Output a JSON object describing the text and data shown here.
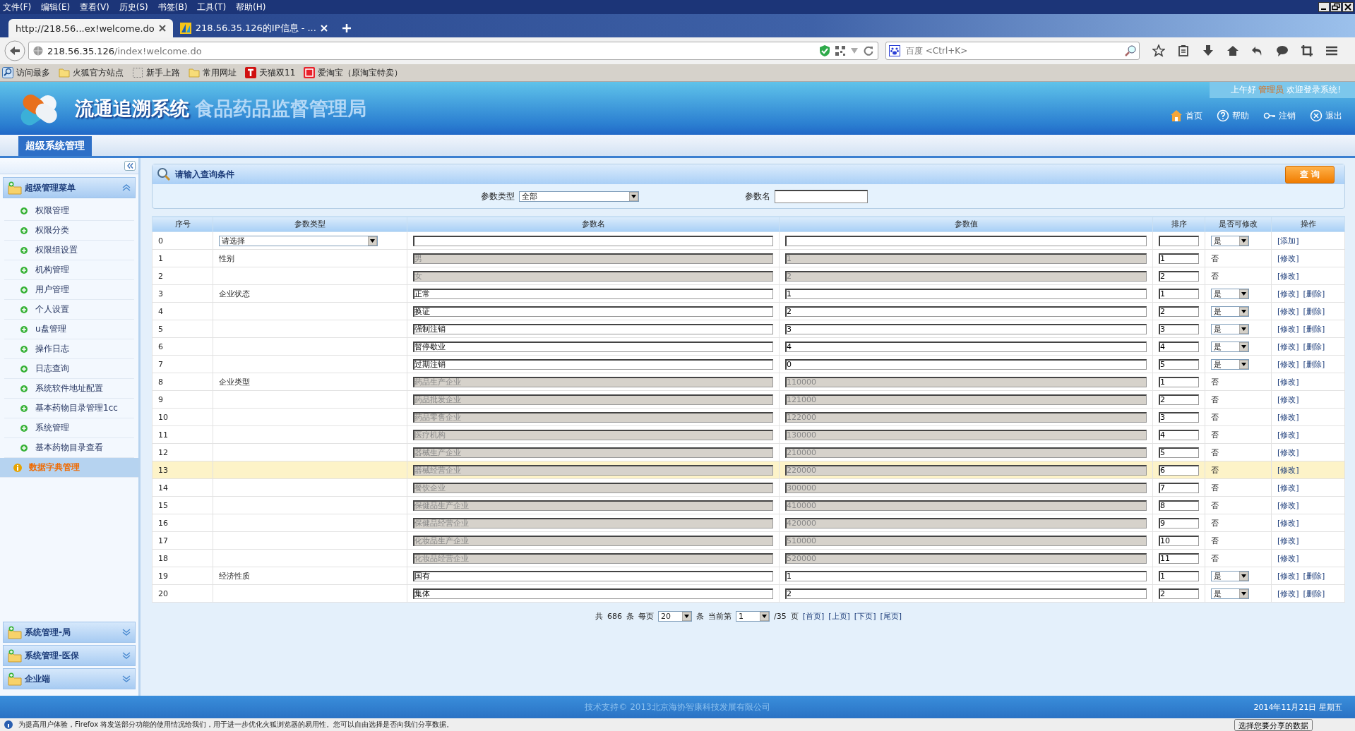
{
  "menu_bar": [
    "文件(F)",
    "编辑(E)",
    "查看(V)",
    "历史(S)",
    "书签(B)",
    "工具(T)",
    "帮助(H)"
  ],
  "tabs": [
    {
      "label": "http://218.56...ex!welcome.do",
      "selected": true
    },
    {
      "label": "218.56.35.126的IP信息 - ...",
      "selected": false
    }
  ],
  "address": {
    "host": "218.56.35.126",
    "path": "/index!welcome.do"
  },
  "search": {
    "placeholder": "百度 <Ctrl+K>"
  },
  "bookmarks": [
    {
      "label": "访问最多",
      "kind": "search"
    },
    {
      "label": "火狐官方站点",
      "kind": "folder"
    },
    {
      "label": "新手上路",
      "kind": "blank"
    },
    {
      "label": "常用网址",
      "kind": "folder"
    },
    {
      "label": "天猫双11",
      "kind": "tmall"
    },
    {
      "label": "爱淘宝（原淘宝特卖）",
      "kind": "taobao"
    }
  ],
  "header": {
    "title": "流通追溯系统",
    "subtitle": "食品药品监督管理局",
    "greeting": "上午好",
    "user": "管理员",
    "welcome": "欢迎登录系统!",
    "links": [
      {
        "label": "首页",
        "kind": "home"
      },
      {
        "label": "帮助",
        "kind": "help"
      },
      {
        "label": "注销",
        "kind": "key"
      },
      {
        "label": "退出",
        "kind": "exit"
      }
    ]
  },
  "top_tab": "超级系统管理",
  "sidebar": {
    "groups": [
      {
        "label": "超级管理菜单",
        "expanded": true,
        "items": [
          {
            "label": "权限管理",
            "selected": false
          },
          {
            "label": "权限分类",
            "selected": false
          },
          {
            "label": "权限组设置",
            "selected": false
          },
          {
            "label": "机构管理",
            "selected": false
          },
          {
            "label": "用户管理",
            "selected": false
          },
          {
            "label": "个人设置",
            "selected": false
          },
          {
            "label": "u盘管理",
            "selected": false
          },
          {
            "label": "操作日志",
            "selected": false
          },
          {
            "label": "日志查询",
            "selected": false
          },
          {
            "label": "系统软件地址配置",
            "selected": false
          },
          {
            "label": "基本药物目录管理1cc",
            "selected": false
          },
          {
            "label": "系统管理",
            "selected": false
          },
          {
            "label": "基本药物目录查看",
            "selected": false
          },
          {
            "label": "数据字典管理",
            "selected": true
          }
        ]
      },
      {
        "label": "系统管理-局",
        "expanded": false
      },
      {
        "label": "系统管理-医保",
        "expanded": false
      },
      {
        "label": "企业端",
        "expanded": false
      }
    ]
  },
  "query": {
    "title": "请输入查询条件",
    "button": "查 询",
    "type_label": "参数类型",
    "type_value": "全部",
    "name_label": "参数名"
  },
  "table": {
    "columns": [
      "序号",
      "参数类型",
      "参数名",
      "参数值",
      "排序",
      "是否可修改",
      "操作"
    ],
    "rows": [
      {
        "kind": "new",
        "no": "0",
        "type": "请选择",
        "name": "",
        "value": "",
        "sort": "",
        "modifiable": "是",
        "ops": [
          "[添加]"
        ],
        "selected": false
      },
      {
        "kind": "fixed",
        "no": "1",
        "type": "性别",
        "name": "男",
        "value": "1",
        "sort": "1",
        "modifiable": "否",
        "ops": [
          "[修改]"
        ],
        "selected": false
      },
      {
        "kind": "fixed",
        "no": "2",
        "type": "",
        "name": "女",
        "value": "2",
        "sort": "2",
        "modifiable": "否",
        "ops": [
          "[修改]"
        ],
        "selected": false
      },
      {
        "kind": "editable",
        "no": "3",
        "type": "企业状态",
        "name": "正常",
        "value": "1",
        "sort": "1",
        "modifiable": "是",
        "ops": [
          "[修改]",
          "[删除]"
        ],
        "selected": false
      },
      {
        "kind": "editable",
        "no": "4",
        "type": "",
        "name": "换证",
        "value": "2",
        "sort": "2",
        "modifiable": "是",
        "ops": [
          "[修改]",
          "[删除]"
        ],
        "selected": false
      },
      {
        "kind": "editable",
        "no": "5",
        "type": "",
        "name": "强制注销",
        "value": "3",
        "sort": "3",
        "modifiable": "是",
        "ops": [
          "[修改]",
          "[删除]"
        ],
        "selected": false
      },
      {
        "kind": "editable",
        "no": "6",
        "type": "",
        "name": "暂停歇业",
        "value": "4",
        "sort": "4",
        "modifiable": "是",
        "ops": [
          "[修改]",
          "[删除]"
        ],
        "selected": false
      },
      {
        "kind": "editable",
        "no": "7",
        "type": "",
        "name": "过期注销",
        "value": "0",
        "sort": "5",
        "modifiable": "是",
        "ops": [
          "[修改]",
          "[删除]"
        ],
        "selected": false
      },
      {
        "kind": "fixed",
        "no": "8",
        "type": "企业类型",
        "name": "药品生产企业",
        "value": "110000",
        "sort": "1",
        "modifiable": "否",
        "ops": [
          "[修改]"
        ],
        "selected": false
      },
      {
        "kind": "fixed",
        "no": "9",
        "type": "",
        "name": "药品批发企业",
        "value": "121000",
        "sort": "2",
        "modifiable": "否",
        "ops": [
          "[修改]"
        ],
        "selected": false
      },
      {
        "kind": "fixed",
        "no": "10",
        "type": "",
        "name": "药品零售企业",
        "value": "122000",
        "sort": "3",
        "modifiable": "否",
        "ops": [
          "[修改]"
        ],
        "selected": false
      },
      {
        "kind": "fixed",
        "no": "11",
        "type": "",
        "name": "医疗机构",
        "value": "130000",
        "sort": "4",
        "modifiable": "否",
        "ops": [
          "[修改]"
        ],
        "selected": false
      },
      {
        "kind": "fixed",
        "no": "12",
        "type": "",
        "name": "器械生产企业",
        "value": "210000",
        "sort": "5",
        "modifiable": "否",
        "ops": [
          "[修改]"
        ],
        "selected": false
      },
      {
        "kind": "fixed",
        "no": "13",
        "type": "",
        "name": "器械经营企业",
        "value": "220000",
        "sort": "6",
        "modifiable": "否",
        "ops": [
          "[修改]"
        ],
        "selected": true
      },
      {
        "kind": "fixed",
        "no": "14",
        "type": "",
        "name": "餐饮企业",
        "value": "300000",
        "sort": "7",
        "modifiable": "否",
        "ops": [
          "[修改]"
        ],
        "selected": false
      },
      {
        "kind": "fixed",
        "no": "15",
        "type": "",
        "name": "保健品生产企业",
        "value": "410000",
        "sort": "8",
        "modifiable": "否",
        "ops": [
          "[修改]"
        ],
        "selected": false
      },
      {
        "kind": "fixed",
        "no": "16",
        "type": "",
        "name": "保健品经营企业",
        "value": "420000",
        "sort": "9",
        "modifiable": "否",
        "ops": [
          "[修改]"
        ],
        "selected": false
      },
      {
        "kind": "fixed",
        "no": "17",
        "type": "",
        "name": "化妆品生产企业",
        "value": "510000",
        "sort": "10",
        "modifiable": "否",
        "ops": [
          "[修改]"
        ],
        "selected": false
      },
      {
        "kind": "fixed",
        "no": "18",
        "type": "",
        "name": "化妆品经营企业",
        "value": "520000",
        "sort": "11",
        "modifiable": "否",
        "ops": [
          "[修改]"
        ],
        "selected": false
      },
      {
        "kind": "editable",
        "no": "19",
        "type": "经济性质",
        "name": "国有",
        "value": "1",
        "sort": "1",
        "modifiable": "是",
        "ops": [
          "[修改]",
          "[删除]"
        ],
        "selected": false
      },
      {
        "kind": "editable",
        "no": "20",
        "type": "",
        "name": "集体",
        "value": "2",
        "sort": "2",
        "modifiable": "是",
        "ops": [
          "[修改]",
          "[删除]"
        ],
        "selected": false
      }
    ]
  },
  "pagination": {
    "total_prefix": "共",
    "total": "686",
    "unit1": "条",
    "per_page_label": "每页",
    "per_page": "20",
    "unit2": "条",
    "current_label": "当前第",
    "current": "1",
    "pages": "/35",
    "unit3": "页",
    "links": [
      "[首页]",
      "[上页]",
      "[下页]",
      "[尾页]"
    ]
  },
  "footer": {
    "copyright": "技术支持©  2013北京海协智康科技发展有限公司",
    "date": "2014年11月21日 星期五"
  },
  "notification": {
    "text": "为提高用户体验，Firefox 将发送部分功能的使用情况给我们，用于进一步优化火狐浏览器的易用性。您可以自由选择是否向我们分享数据。",
    "button": "选择您要分享的数据"
  }
}
